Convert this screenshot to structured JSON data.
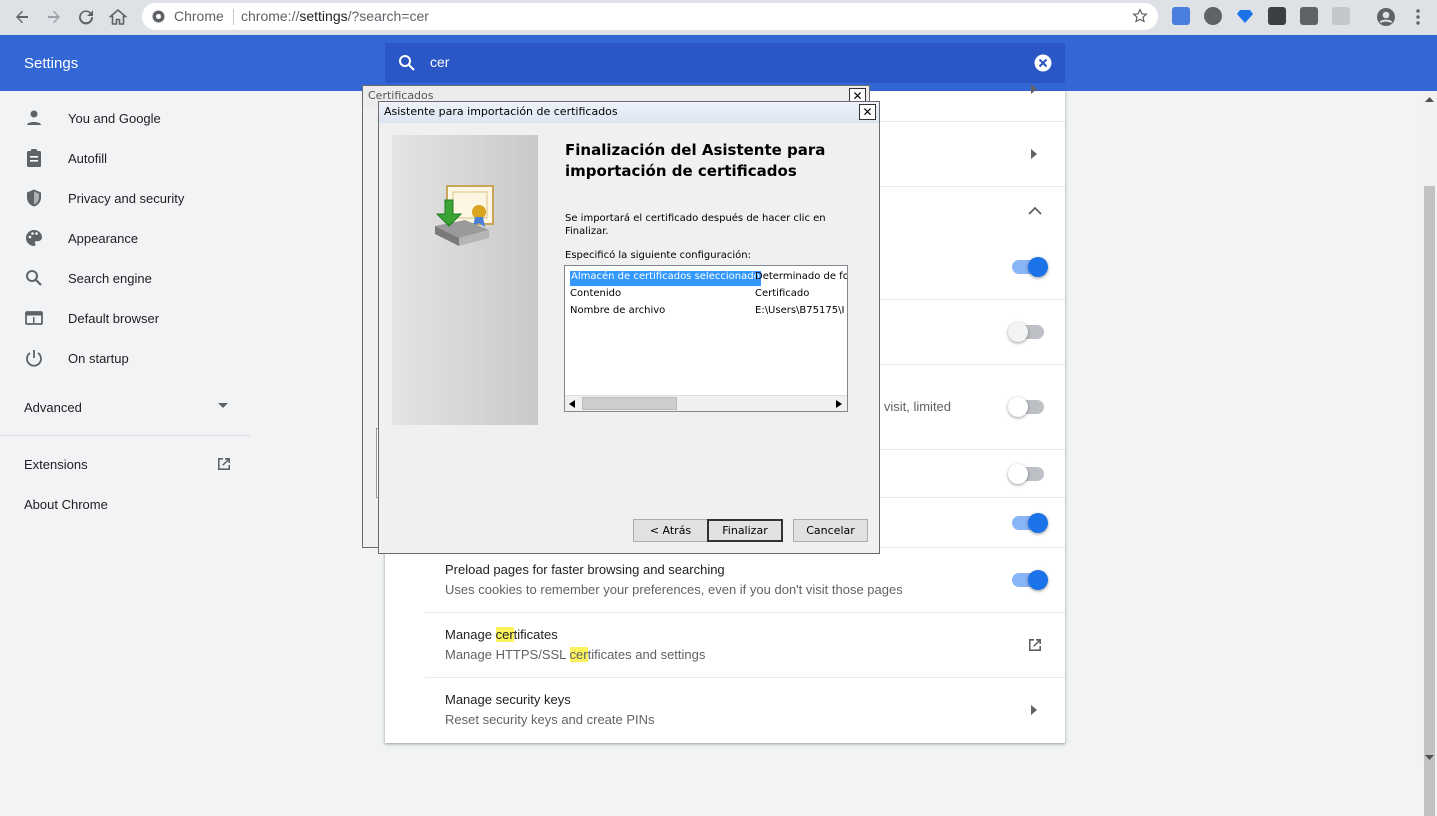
{
  "browser": {
    "site_label": "Chrome",
    "url_prefix": "chrome://",
    "url_host": "settings",
    "url_rest": "/?search=cer"
  },
  "header": {
    "title": "Settings",
    "search_value": "cer"
  },
  "sidebar": {
    "items": [
      {
        "label": "You and Google",
        "icon": "person-icon"
      },
      {
        "label": "Autofill",
        "icon": "clipboard-icon"
      },
      {
        "label": "Privacy and security",
        "icon": "shield-icon"
      },
      {
        "label": "Appearance",
        "icon": "palette-icon"
      },
      {
        "label": "Search engine",
        "icon": "search-icon"
      },
      {
        "label": "Default browser",
        "icon": "browser-window-icon"
      },
      {
        "label": "On startup",
        "icon": "power-icon"
      }
    ],
    "advanced": "Advanced",
    "extensions": "Extensions",
    "about": "About Chrome"
  },
  "card": {
    "partial_text": "u visit, limited",
    "preload_title": "Preload pages for faster browsing and searching",
    "preload_sub": "Uses cookies to remember your preferences, even if you don't visit those pages",
    "certs_title_pre": "Manage ",
    "certs_title_hl": "cer",
    "certs_title_post": "tificates",
    "certs_sub_pre": "Manage HTTPS/SSL ",
    "certs_sub_hl": "cer",
    "certs_sub_post": "tificates and settings",
    "keys_title": "Manage security keys",
    "keys_sub": "Reset security keys and create PINs",
    "toggles": [
      {
        "state": "on"
      },
      {
        "state": "off"
      },
      {
        "state": "off"
      },
      {
        "state": "off"
      },
      {
        "state": "on"
      },
      {
        "state": "on"
      }
    ]
  },
  "cert_window": {
    "title": "Certificados"
  },
  "wizard": {
    "title": "Asistente para importación de certificados",
    "heading_line1": "Finalización del Asistente para",
    "heading_line2": "importación de certificados",
    "desc_line1": "Se importará el certificado después de hacer clic en",
    "desc_line2": "Finalizar.",
    "config_label": "Especificó la siguiente configuración:",
    "rows": [
      {
        "name": "Almacén de certificados seleccionado",
        "value": "Determinado de fo"
      },
      {
        "name": "Contenido",
        "value": "Certificado"
      },
      {
        "name": "Nombre de archivo",
        "value": "E:\\Users\\B75175\\I"
      }
    ],
    "back": "< Atrás",
    "finish": "Finalizar",
    "cancel": "Cancelar"
  },
  "colors": {
    "header_blue": "#3367d6",
    "accent_blue": "#1a73e8",
    "highlight_yellow": "#fcf25b",
    "selection_blue": "#3399ff"
  }
}
